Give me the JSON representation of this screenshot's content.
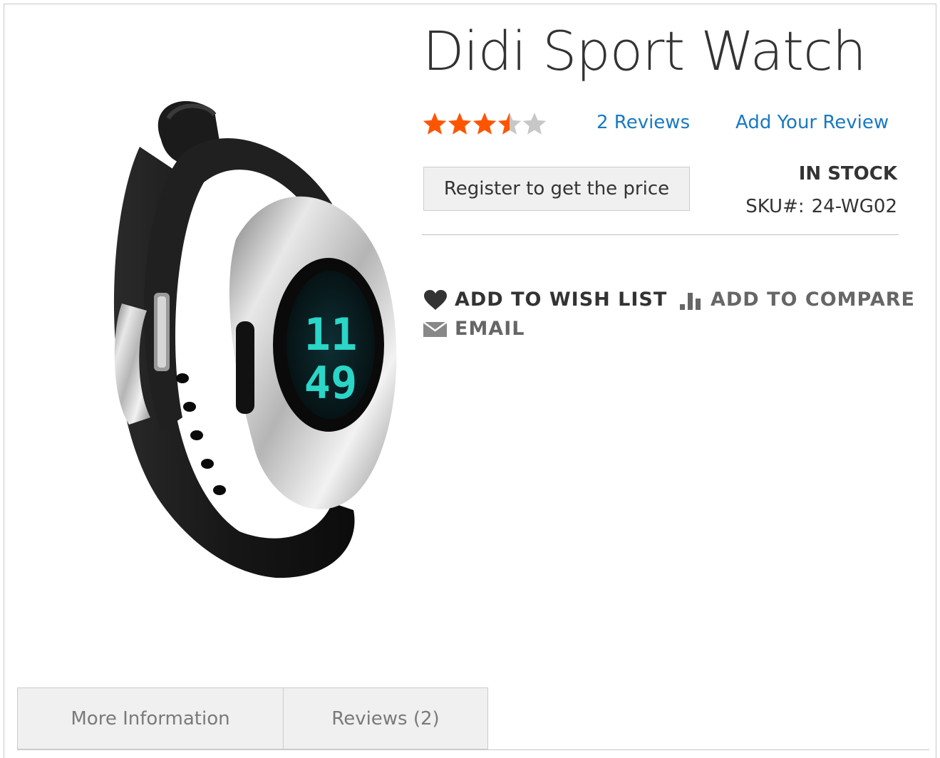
{
  "product": {
    "title": "Didi Sport Watch",
    "watch_display": {
      "hour": "11",
      "minute": "49"
    },
    "rating": {
      "value": 3.5,
      "max": 5
    },
    "reviews_link": "2 Reviews",
    "add_review_link": "Add Your Review",
    "price_button": "Register to get the price",
    "stock_status": "IN STOCK",
    "sku_label": "SKU#:",
    "sku_value": "24-WG02"
  },
  "actions": {
    "wishlist": {
      "label": "ADD TO WISH LIST",
      "icon": "heart-icon"
    },
    "compare": {
      "label": "ADD TO COMPARE",
      "icon": "bar-chart-icon"
    },
    "email": {
      "label": "EMAIL",
      "icon": "envelope-icon"
    }
  },
  "tabs": [
    {
      "label": "More Information"
    },
    {
      "label": "Reviews (2)"
    }
  ],
  "colors": {
    "link": "#1979c3",
    "star_filled": "#ff5501",
    "star_empty": "#c7c7c7",
    "text": "#333333",
    "muted": "#666666",
    "watch_screen": "#2ad6c7"
  }
}
